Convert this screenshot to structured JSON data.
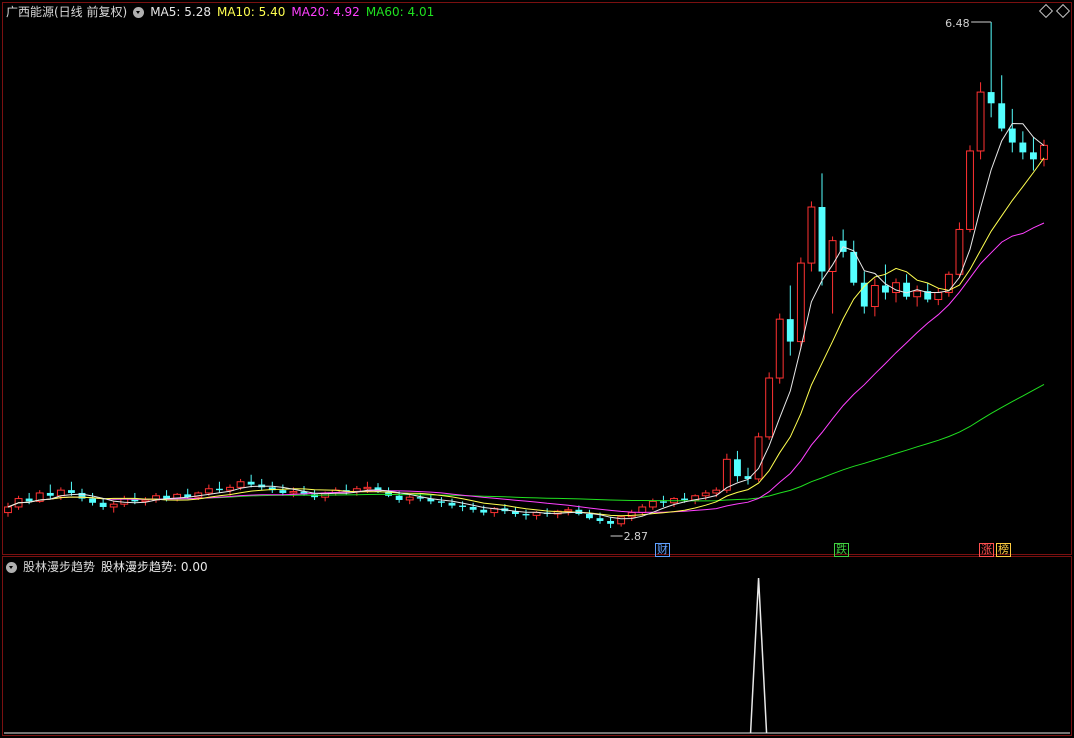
{
  "header": {
    "title": "广西能源(日线 前复权)",
    "ma5_label": "MA5: 5.28",
    "ma10_label": "MA10: 5.40",
    "ma20_label": "MA20: 4.92",
    "ma60_label": "MA60: 4.01"
  },
  "sub_panel": {
    "name": "股林漫步趋势",
    "value_label": "股林漫步趋势: 0.00"
  },
  "price_labels": {
    "high": "6.48",
    "low": "2.87"
  },
  "markers": [
    {
      "text": "财",
      "color": "#60a0ff"
    },
    {
      "text": "跌",
      "color": "#40d040"
    },
    {
      "text": "涨",
      "color": "#ff5050"
    },
    {
      "text": "榜",
      "color": "#ffcc40"
    }
  ],
  "colors": {
    "up": "#ff3232",
    "down": "#54ffff",
    "ma5": "#e8e8e8",
    "ma10": "#ffff50",
    "ma20": "#ff40ff",
    "ma60": "#20e020",
    "frame": "#7a1010"
  },
  "chart_data": {
    "type": "candlestick",
    "price_range": [
      2.87,
      6.48
    ],
    "candles": [
      [
        2.98,
        3.05,
        2.95,
        3.02
      ],
      [
        3.02,
        3.1,
        3.0,
        3.08
      ],
      [
        3.08,
        3.12,
        3.04,
        3.06
      ],
      [
        3.06,
        3.14,
        3.05,
        3.12
      ],
      [
        3.12,
        3.18,
        3.08,
        3.1
      ],
      [
        3.1,
        3.16,
        3.07,
        3.14
      ],
      [
        3.14,
        3.2,
        3.1,
        3.12
      ],
      [
        3.12,
        3.15,
        3.06,
        3.08
      ],
      [
        3.08,
        3.12,
        3.03,
        3.05
      ],
      [
        3.05,
        3.08,
        3.0,
        3.02
      ],
      [
        3.02,
        3.06,
        2.98,
        3.04
      ],
      [
        3.04,
        3.1,
        3.02,
        3.08
      ],
      [
        3.08,
        3.12,
        3.04,
        3.06
      ],
      [
        3.06,
        3.09,
        3.03,
        3.07
      ],
      [
        3.07,
        3.12,
        3.05,
        3.1
      ],
      [
        3.1,
        3.14,
        3.06,
        3.08
      ],
      [
        3.08,
        3.12,
        3.06,
        3.11
      ],
      [
        3.11,
        3.15,
        3.08,
        3.09
      ],
      [
        3.09,
        3.13,
        3.07,
        3.12
      ],
      [
        3.12,
        3.18,
        3.1,
        3.15
      ],
      [
        3.15,
        3.2,
        3.12,
        3.14
      ],
      [
        3.14,
        3.18,
        3.1,
        3.16
      ],
      [
        3.16,
        3.22,
        3.14,
        3.2
      ],
      [
        3.2,
        3.25,
        3.16,
        3.18
      ],
      [
        3.18,
        3.22,
        3.14,
        3.16
      ],
      [
        3.16,
        3.2,
        3.12,
        3.14
      ],
      [
        3.14,
        3.18,
        3.1,
        3.12
      ],
      [
        3.12,
        3.16,
        3.09,
        3.13
      ],
      [
        3.13,
        3.17,
        3.1,
        3.11
      ],
      [
        3.11,
        3.14,
        3.07,
        3.09
      ],
      [
        3.09,
        3.13,
        3.06,
        3.12
      ],
      [
        3.12,
        3.16,
        3.1,
        3.14
      ],
      [
        3.14,
        3.18,
        3.11,
        3.13
      ],
      [
        3.13,
        3.17,
        3.1,
        3.15
      ],
      [
        3.15,
        3.2,
        3.12,
        3.16
      ],
      [
        3.16,
        3.19,
        3.12,
        3.13
      ],
      [
        3.13,
        3.16,
        3.09,
        3.1
      ],
      [
        3.1,
        3.13,
        3.05,
        3.07
      ],
      [
        3.07,
        3.11,
        3.04,
        3.09
      ],
      [
        3.09,
        3.12,
        3.06,
        3.08
      ],
      [
        3.08,
        3.11,
        3.04,
        3.06
      ],
      [
        3.06,
        3.09,
        3.02,
        3.05
      ],
      [
        3.05,
        3.08,
        3.01,
        3.03
      ],
      [
        3.03,
        3.06,
        2.99,
        3.02
      ],
      [
        3.02,
        3.05,
        2.98,
        3.0
      ],
      [
        3.0,
        3.03,
        2.96,
        2.98
      ],
      [
        2.98,
        3.02,
        2.95,
        3.01
      ],
      [
        3.01,
        3.04,
        2.97,
        2.99
      ],
      [
        2.99,
        3.02,
        2.95,
        2.97
      ],
      [
        2.97,
        3.0,
        2.93,
        2.96
      ],
      [
        2.96,
        2.99,
        2.93,
        2.98
      ],
      [
        2.98,
        3.01,
        2.95,
        2.97
      ],
      [
        2.97,
        3.0,
        2.94,
        2.99
      ],
      [
        2.99,
        3.02,
        2.96,
        3.0
      ],
      [
        3.0,
        3.03,
        2.96,
        2.97
      ],
      [
        2.97,
        3.0,
        2.93,
        2.94
      ],
      [
        2.94,
        2.98,
        2.9,
        2.92
      ],
      [
        2.92,
        2.95,
        2.87,
        2.9
      ],
      [
        2.9,
        2.96,
        2.88,
        2.95
      ],
      [
        2.95,
        3.0,
        2.92,
        2.98
      ],
      [
        2.98,
        3.04,
        2.96,
        3.02
      ],
      [
        3.02,
        3.08,
        3.0,
        3.06
      ],
      [
        3.06,
        3.1,
        3.02,
        3.05
      ],
      [
        3.05,
        3.09,
        3.02,
        3.08
      ],
      [
        3.08,
        3.12,
        3.05,
        3.07
      ],
      [
        3.07,
        3.11,
        3.04,
        3.1
      ],
      [
        3.1,
        3.14,
        3.07,
        3.12
      ],
      [
        3.12,
        3.16,
        3.09,
        3.14
      ],
      [
        3.14,
        3.4,
        3.12,
        3.36
      ],
      [
        3.36,
        3.42,
        3.2,
        3.24
      ],
      [
        3.24,
        3.3,
        3.18,
        3.22
      ],
      [
        3.22,
        3.55,
        3.2,
        3.52
      ],
      [
        3.52,
        3.98,
        3.5,
        3.94
      ],
      [
        3.94,
        4.4,
        3.9,
        4.36
      ],
      [
        4.36,
        4.6,
        4.1,
        4.2
      ],
      [
        4.2,
        4.8,
        4.15,
        4.76
      ],
      [
        4.76,
        5.2,
        4.7,
        5.16
      ],
      [
        5.16,
        5.4,
        4.6,
        4.7
      ],
      [
        4.7,
        4.95,
        4.4,
        4.92
      ],
      [
        4.92,
        5.0,
        4.8,
        4.84
      ],
      [
        4.84,
        4.92,
        4.6,
        4.62
      ],
      [
        4.62,
        4.7,
        4.4,
        4.45
      ],
      [
        4.45,
        4.65,
        4.38,
        4.6
      ],
      [
        4.6,
        4.75,
        4.5,
        4.55
      ],
      [
        4.55,
        4.65,
        4.48,
        4.62
      ],
      [
        4.62,
        4.68,
        4.5,
        4.52
      ],
      [
        4.52,
        4.6,
        4.45,
        4.56
      ],
      [
        4.56,
        4.62,
        4.48,
        4.5
      ],
      [
        4.5,
        4.58,
        4.46,
        4.55
      ],
      [
        4.55,
        4.7,
        4.52,
        4.68
      ],
      [
        4.68,
        5.05,
        4.66,
        5.0
      ],
      [
        5.0,
        5.6,
        4.98,
        5.56
      ],
      [
        5.56,
        6.05,
        5.5,
        5.98
      ],
      [
        5.98,
        6.48,
        5.8,
        5.9
      ],
      [
        5.9,
        6.1,
        5.7,
        5.72
      ],
      [
        5.72,
        5.86,
        5.55,
        5.62
      ],
      [
        5.62,
        5.7,
        5.5,
        5.55
      ],
      [
        5.55,
        5.66,
        5.42,
        5.5
      ],
      [
        5.5,
        5.64,
        5.45,
        5.6
      ]
    ],
    "ma5_last": 5.28,
    "ma10_last": 5.4,
    "ma20_last": 4.92,
    "ma60_last": 4.01,
    "indicator": {
      "name": "股林漫步趋势",
      "last_value": 0.0,
      "spike_index": 71,
      "spike_value": 1.0
    }
  }
}
